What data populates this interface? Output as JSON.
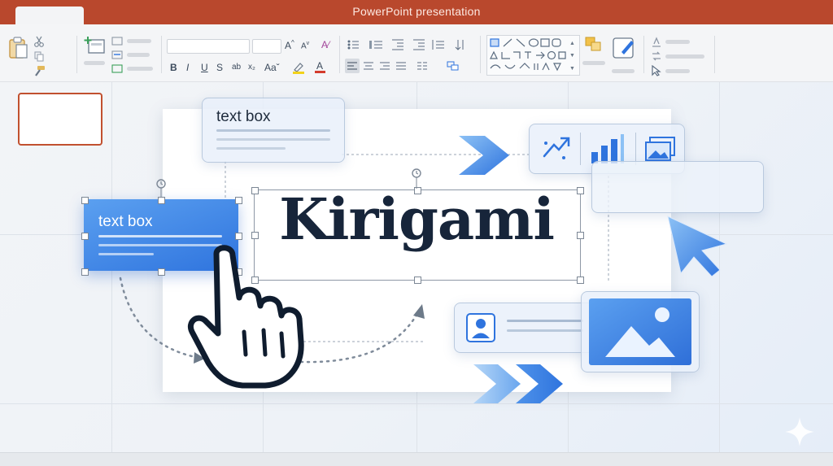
{
  "window": {
    "title": "PowerPoint presentation"
  },
  "canvas": {
    "text_box_top_label": "text box",
    "text_box_selected_label": "text box",
    "title_text": "Kirigami"
  },
  "icons": {
    "ribbon": [
      "paste-icon",
      "cut-icon",
      "copy-icon",
      "format-painter-icon",
      "new-slide-icon",
      "layout-icon",
      "bold-icon",
      "italic-icon",
      "underline-icon",
      "strikethrough-icon",
      "highlight-icon",
      "font-color-icon",
      "bullets-icon",
      "numbering-icon",
      "align-left-icon",
      "align-center-icon",
      "shapes-gallery-icon",
      "arrange-icon",
      "quick-styles-icon",
      "find-icon",
      "replace-icon",
      "select-icon"
    ],
    "canvas": [
      "hand-pointer-icon",
      "cursor-arrow-icon",
      "chevron-arrows-icon",
      "smartart-icon",
      "chart-icon",
      "image-icon",
      "contact-icon",
      "picture-icon",
      "sparkle-icon"
    ]
  },
  "colors": {
    "titlebar": "#b9482d",
    "accent_blue": "#2f74de",
    "slide_text": "#17253a"
  }
}
